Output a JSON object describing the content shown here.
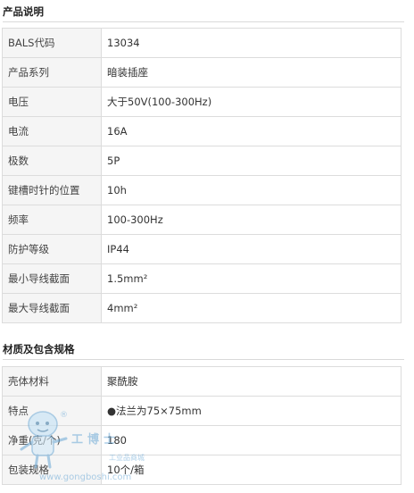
{
  "sections": [
    {
      "title": "产品说明",
      "rows": [
        {
          "label": "BALS代码",
          "value": "13034"
        },
        {
          "label": "产品系列",
          "value": "暗装插座"
        },
        {
          "label": "电压",
          "value": "大于50V(100-300Hz)"
        },
        {
          "label": "电流",
          "value": "16A"
        },
        {
          "label": "极数",
          "value": "5P"
        },
        {
          "label": "键槽时针的位置",
          "value": "10h"
        },
        {
          "label": "频率",
          "value": "100-300Hz"
        },
        {
          "label": "防护等级",
          "value": "IP44"
        },
        {
          "label": "最小导线截面",
          "value": "1.5mm²"
        },
        {
          "label": "最大导线截面",
          "value": "4mm²"
        }
      ]
    },
    {
      "title": "材质及包含规格",
      "rows": [
        {
          "label": "壳体材料",
          "value": "聚酰胺"
        },
        {
          "label": "特点",
          "value": "●法兰为75×75mm"
        },
        {
          "label": "净重(克/个)",
          "value": "180"
        },
        {
          "label": "包装规格",
          "value": "10个/箱"
        }
      ]
    }
  ],
  "watermark": {
    "brand": "工博士",
    "tagline": "工业品商城",
    "url": "www.gongboshi.com",
    "mark": "®"
  }
}
